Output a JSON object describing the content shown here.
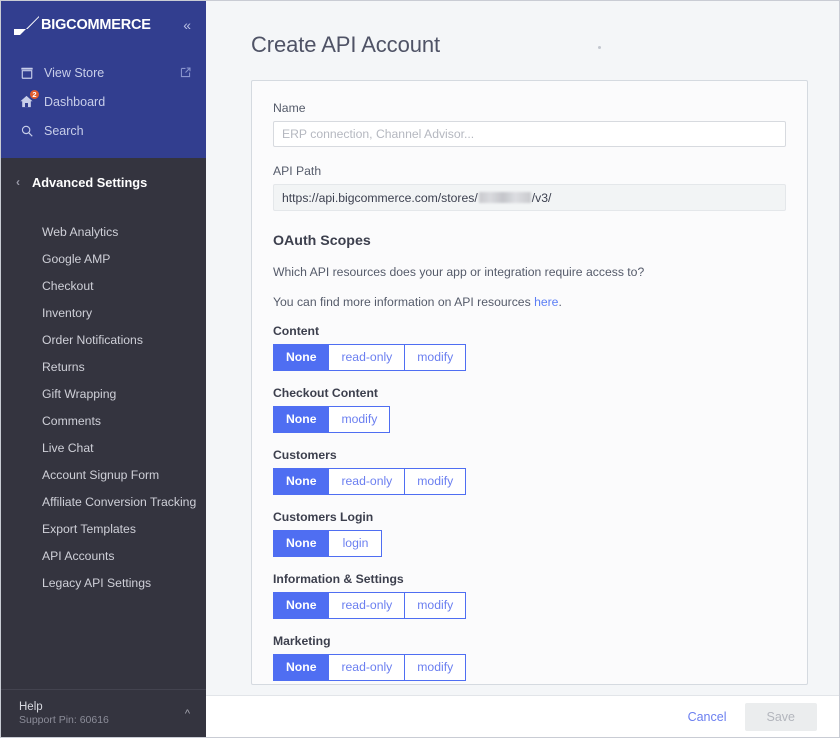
{
  "sidebar": {
    "brand": {
      "name": "BIGCOMMERCE",
      "logo_icon": "bigcommerce-logo-icon"
    },
    "collapse_icon": "chevron-double-left-icon",
    "top_links": [
      {
        "label": "View Store",
        "icon": "storefront-icon",
        "trailing_icon": "external-link-icon",
        "badge": null
      },
      {
        "label": "Dashboard",
        "icon": "home-icon",
        "trailing_icon": null,
        "badge": "2"
      },
      {
        "label": "Search",
        "icon": "search-icon",
        "trailing_icon": null,
        "badge": null
      }
    ],
    "section": {
      "label": "Advanced Settings",
      "back_icon": "chevron-left-icon"
    },
    "items": [
      {
        "label": "Web Analytics"
      },
      {
        "label": "Google AMP"
      },
      {
        "label": "Checkout"
      },
      {
        "label": "Inventory"
      },
      {
        "label": "Order Notifications"
      },
      {
        "label": "Returns"
      },
      {
        "label": "Gift Wrapping"
      },
      {
        "label": "Comments"
      },
      {
        "label": "Live Chat"
      },
      {
        "label": "Account Signup Form"
      },
      {
        "label": "Affiliate Conversion Tracking"
      },
      {
        "label": "Export Templates"
      },
      {
        "label": "API Accounts"
      },
      {
        "label": "Legacy API Settings"
      }
    ],
    "help": {
      "title": "Help",
      "subtitle": "Support Pin: 60616",
      "chevron_icon": "chevron-up-icon"
    },
    "colors": {
      "top_bg": "#323e8f",
      "body_bg": "#34343f",
      "badge": "#e05c2e"
    }
  },
  "main": {
    "page_title": "Create API Account",
    "name_field": {
      "label": "Name",
      "value": "",
      "placeholder": "ERP connection, Channel Advisor..."
    },
    "api_path_field": {
      "label": "API Path",
      "prefix": "https://api.bigcommerce.com/stores/",
      "redacted": "",
      "suffix": "/v3/"
    },
    "oauth": {
      "heading": "OAuth Scopes",
      "question": "Which API resources does your app or integration require access to?",
      "info_prefix": "You can find more information on API resources ",
      "info_link": "here",
      "info_suffix": "."
    },
    "scopes": [
      {
        "label": "Content",
        "options": [
          "None",
          "read-only",
          "modify"
        ],
        "selected": "None"
      },
      {
        "label": "Checkout Content",
        "options": [
          "None",
          "modify"
        ],
        "selected": "None"
      },
      {
        "label": "Customers",
        "options": [
          "None",
          "read-only",
          "modify"
        ],
        "selected": "None"
      },
      {
        "label": "Customers Login",
        "options": [
          "None",
          "login"
        ],
        "selected": "None"
      },
      {
        "label": "Information & Settings",
        "options": [
          "None",
          "read-only",
          "modify"
        ],
        "selected": "None"
      },
      {
        "label": "Marketing",
        "options": [
          "None",
          "read-only",
          "modify"
        ],
        "selected": "None"
      }
    ],
    "footer": {
      "cancel_label": "Cancel",
      "save_label": "Save",
      "save_disabled": true
    },
    "colors": {
      "accent": "#4f6ef2",
      "link": "#6b7ff0"
    }
  }
}
